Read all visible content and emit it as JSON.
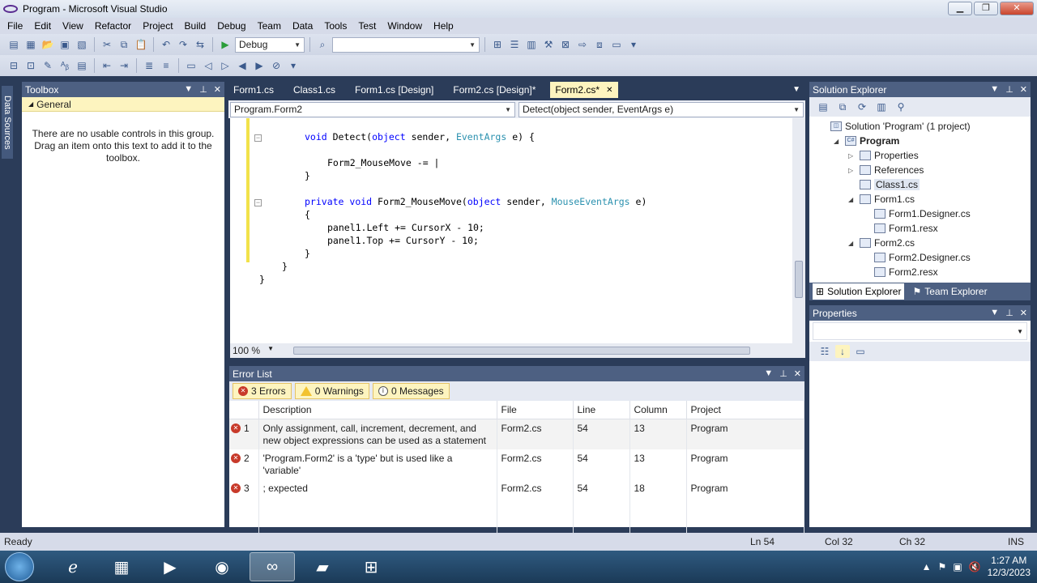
{
  "window": {
    "title": "Program - Microsoft Visual Studio"
  },
  "menu": [
    "File",
    "Edit",
    "View",
    "Refactor",
    "Project",
    "Build",
    "Debug",
    "Team",
    "Data",
    "Tools",
    "Test",
    "Window",
    "Help"
  ],
  "toolbar": {
    "config": "Debug",
    "platform": ""
  },
  "datasources_tab": "Data Sources",
  "toolbox": {
    "title": "Toolbox",
    "group": "General",
    "message": "There are no usable controls in this group. Drag an item onto this text to add it to the toolbox."
  },
  "editor": {
    "tabs": [
      "Form1.cs",
      "Class1.cs",
      "Form1.cs [Design]",
      "Form2.cs [Design]*",
      "Form2.cs*"
    ],
    "active_tab": "Form2.cs*",
    "nav_left": "Program.Form2",
    "nav_right": "Detect(object sender, EventArgs e)",
    "zoom": "100 %",
    "lines": [
      {
        "indent": 8,
        "parts": [
          {
            "t": "void",
            "c": "kw"
          },
          {
            "t": " Detect("
          },
          {
            "t": "object",
            "c": "kw"
          },
          {
            "t": " sender, "
          },
          {
            "t": "EventArgs",
            "c": "ty"
          },
          {
            "t": " e) {"
          }
        ]
      },
      {
        "indent": 12,
        "parts": [
          {
            "t": "Form2_MouseMove -= |"
          }
        ]
      },
      {
        "indent": 8,
        "parts": [
          {
            "t": "}"
          }
        ]
      },
      {
        "indent": 8,
        "parts": [
          {
            "t": "private",
            "c": "kw"
          },
          {
            "t": " "
          },
          {
            "t": "void",
            "c": "kw"
          },
          {
            "t": " Form2_MouseMove("
          },
          {
            "t": "object",
            "c": "kw"
          },
          {
            "t": " sender, "
          },
          {
            "t": "MouseEventArgs",
            "c": "ty"
          },
          {
            "t": " e)"
          }
        ]
      },
      {
        "indent": 8,
        "parts": [
          {
            "t": "{"
          }
        ]
      },
      {
        "indent": 12,
        "parts": [
          {
            "t": "panel1.Left += CursorX - 10;"
          }
        ]
      },
      {
        "indent": 12,
        "parts": [
          {
            "t": "panel1.Top += CursorY - 10;"
          }
        ]
      },
      {
        "indent": 8,
        "parts": [
          {
            "t": "}"
          }
        ]
      },
      {
        "indent": 4,
        "parts": [
          {
            "t": "}"
          }
        ]
      },
      {
        "indent": 0,
        "parts": [
          {
            "t": "}"
          }
        ]
      }
    ]
  },
  "errorlist": {
    "title": "Error List",
    "filters": {
      "errors": "3 Errors",
      "warnings": "0 Warnings",
      "messages": "0 Messages"
    },
    "columns": [
      "Description",
      "File",
      "Line",
      "Column",
      "Project"
    ],
    "rows": [
      {
        "n": "1",
        "description": "Only assignment, call, increment, decrement, and new object expressions can be used as a statement",
        "file": "Form2.cs",
        "line": "54",
        "column": "13",
        "project": "Program"
      },
      {
        "n": "2",
        "description": "'Program.Form2' is a 'type' but is used like a 'variable'",
        "file": "Form2.cs",
        "line": "54",
        "column": "13",
        "project": "Program"
      },
      {
        "n": "3",
        "description": "; expected",
        "file": "Form2.cs",
        "line": "54",
        "column": "18",
        "project": "Program"
      }
    ]
  },
  "solution_explorer": {
    "title": "Solution Explorer",
    "items": [
      {
        "label": "Solution 'Program' (1 project)",
        "level": 0,
        "exp": ""
      },
      {
        "label": "Program",
        "level": 1,
        "exp": "◢",
        "bold": true
      },
      {
        "label": "Properties",
        "level": 2,
        "exp": "▷"
      },
      {
        "label": "References",
        "level": 2,
        "exp": "▷"
      },
      {
        "label": "Class1.cs",
        "level": 2,
        "exp": "",
        "selected": true
      },
      {
        "label": "Form1.cs",
        "level": 2,
        "exp": "◢"
      },
      {
        "label": "Form1.Designer.cs",
        "level": 3,
        "exp": ""
      },
      {
        "label": "Form1.resx",
        "level": 3,
        "exp": ""
      },
      {
        "label": "Form2.cs",
        "level": 2,
        "exp": "◢"
      },
      {
        "label": "Form2.Designer.cs",
        "level": 3,
        "exp": ""
      },
      {
        "label": "Form2.resx",
        "level": 3,
        "exp": ""
      }
    ],
    "tab_solution": "Solution Explorer",
    "tab_team": "Team Explorer"
  },
  "properties": {
    "title": "Properties"
  },
  "status": {
    "ready": "Ready",
    "ln": "Ln 54",
    "col": "Col 32",
    "ch": "Ch 32",
    "mode": "INS"
  },
  "taskbar": {
    "time": "1:27 AM",
    "date": "12/3/2023"
  }
}
